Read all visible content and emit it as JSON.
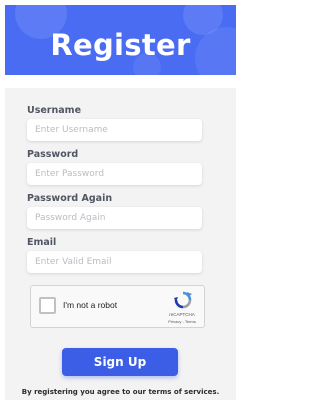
{
  "header": {
    "title": "Register"
  },
  "fields": [
    {
      "label": "Username",
      "placeholder": "Enter Username"
    },
    {
      "label": "Password",
      "placeholder": "Enter Password"
    },
    {
      "label": "Password Again",
      "placeholder": "Password Again"
    },
    {
      "label": "Email",
      "placeholder": "Enter Valid Email"
    }
  ],
  "captcha": {
    "label": "I'm not a robot",
    "brand": "reCAPTCHA",
    "privacy": "Privacy",
    "separator": " - ",
    "terms": "Terms"
  },
  "submit": {
    "label": "Sign Up"
  },
  "footer": {
    "terms_text": "By registering you agree to our terms of services."
  },
  "colors": {
    "header_bg": "#4a6cf3",
    "button_bg": "#3c5ee6",
    "form_bg": "#f3f3f3"
  }
}
